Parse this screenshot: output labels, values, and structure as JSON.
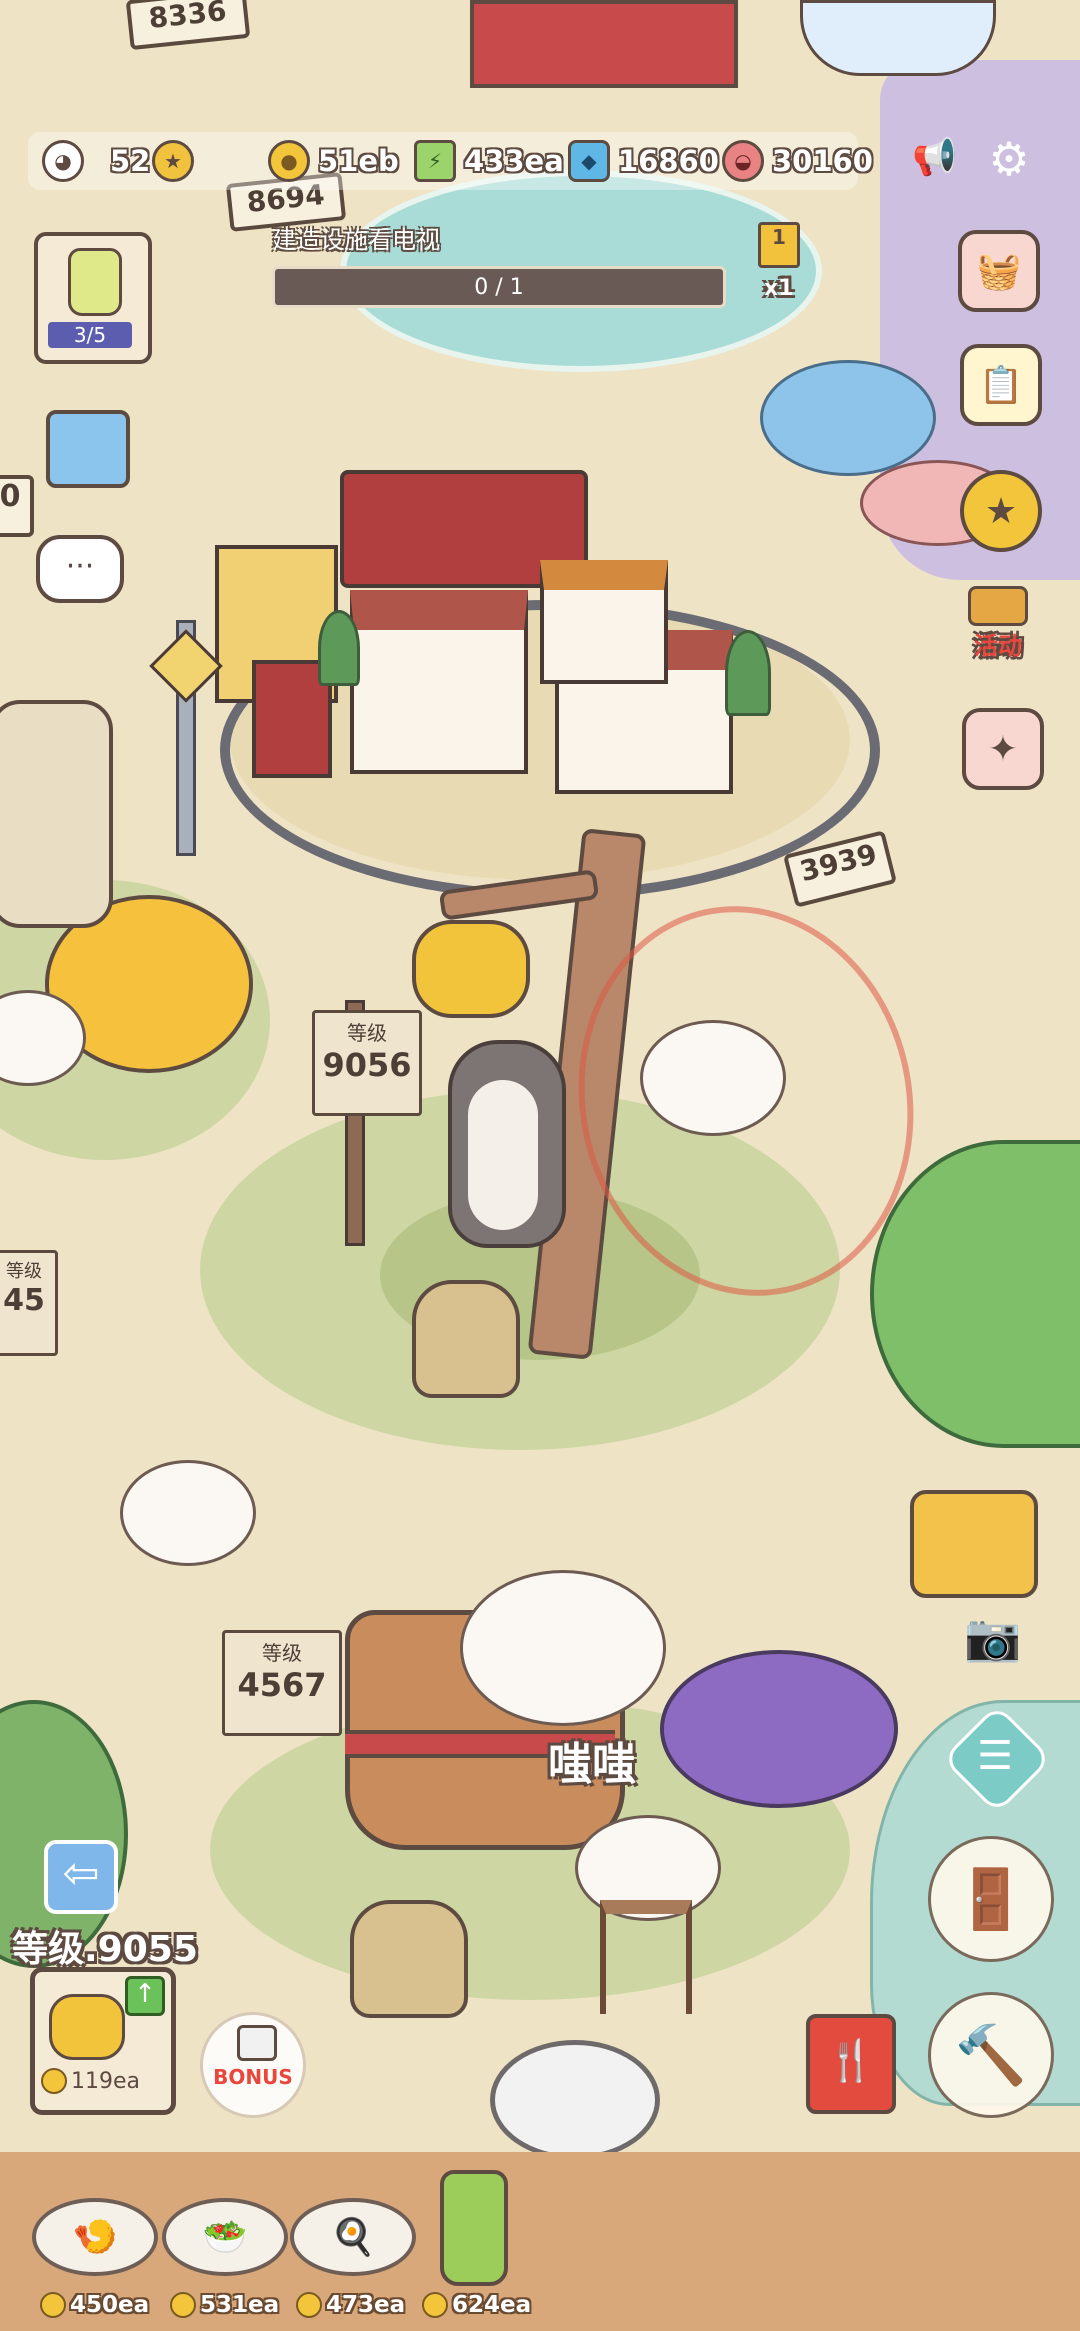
{
  "hud": {
    "cats": "52",
    "coins": "51eb",
    "energy": "433ea",
    "gems": "16860",
    "food": "30160"
  },
  "quest": {
    "title": "建造设施看电视",
    "progress": "0 / 1",
    "progress_fraction": 0,
    "reward_multiplier": "x1",
    "reward_count": "1"
  },
  "jar": {
    "count": "3/5"
  },
  "events_label": "活动",
  "signs": {
    "top_left": "8336",
    "top_mid": "8694",
    "left_edge": "0",
    "right_train": "3939",
    "honey_level_label": "等级",
    "honey_level": "9056",
    "left_level_label": "等级",
    "left_level": "45",
    "grape_level_label": "等级",
    "grape_level": "4567"
  },
  "cat_name": "嗤嗤",
  "facility": {
    "level_label": "等级.9055",
    "upgrade_cost": "119ea",
    "bonus_label": "BONUS"
  },
  "shop": [
    {
      "icon": "shrimp-dish",
      "price": "450ea"
    },
    {
      "icon": "salad-dish",
      "price": "531ea"
    },
    {
      "icon": "omelette-dish",
      "price": "473ea"
    },
    {
      "icon": "juice-bottle",
      "price": "624ea"
    }
  ],
  "colors": {
    "sand": "#efe3c6",
    "grass": "#c6d39a",
    "accent_brown": "#5d4a40",
    "coin_gold": "#f3c53b"
  }
}
